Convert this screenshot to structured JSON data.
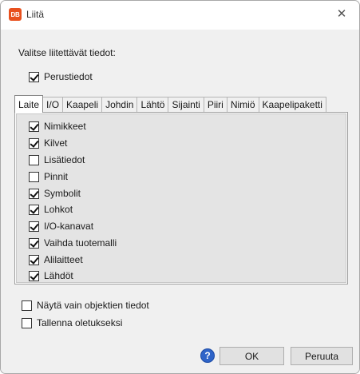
{
  "window": {
    "title": "Liitä",
    "app_icon": "DB",
    "accent": "#e8501e"
  },
  "dialog": {
    "select_label": "Valitse liitettävät tiedot:",
    "basic_info": {
      "label": "Perustiedot",
      "checked": true
    }
  },
  "tabs": [
    "Laite",
    "I/O",
    "Kaapeli",
    "Johdin",
    "Lähtö",
    "Sijainti",
    "Piiri",
    "Nimiö",
    "Kaapelipaketti"
  ],
  "active_tab": "Laite",
  "items": [
    {
      "label": "Nimikkeet",
      "checked": true
    },
    {
      "label": "Kilvet",
      "checked": true
    },
    {
      "label": "Lisätiedot",
      "checked": false
    },
    {
      "label": "Pinnit",
      "checked": false
    },
    {
      "label": "Symbolit",
      "checked": true
    },
    {
      "label": "Lohkot",
      "checked": true
    },
    {
      "label": "I/O-kanavat",
      "checked": true
    },
    {
      "label": "Vaihda tuotemalli",
      "checked": true
    },
    {
      "label": "Alilaitteet",
      "checked": true
    },
    {
      "label": "Lähdöt",
      "checked": true
    }
  ],
  "options": {
    "only_objects": {
      "label": "Näytä vain objektien tiedot",
      "checked": false
    },
    "save_default": {
      "label": "Tallenna oletukseksi",
      "checked": false
    }
  },
  "buttons": {
    "ok": "OK",
    "cancel": "Peruuta"
  },
  "icons": {
    "help": "help-icon",
    "close": "close-icon"
  }
}
